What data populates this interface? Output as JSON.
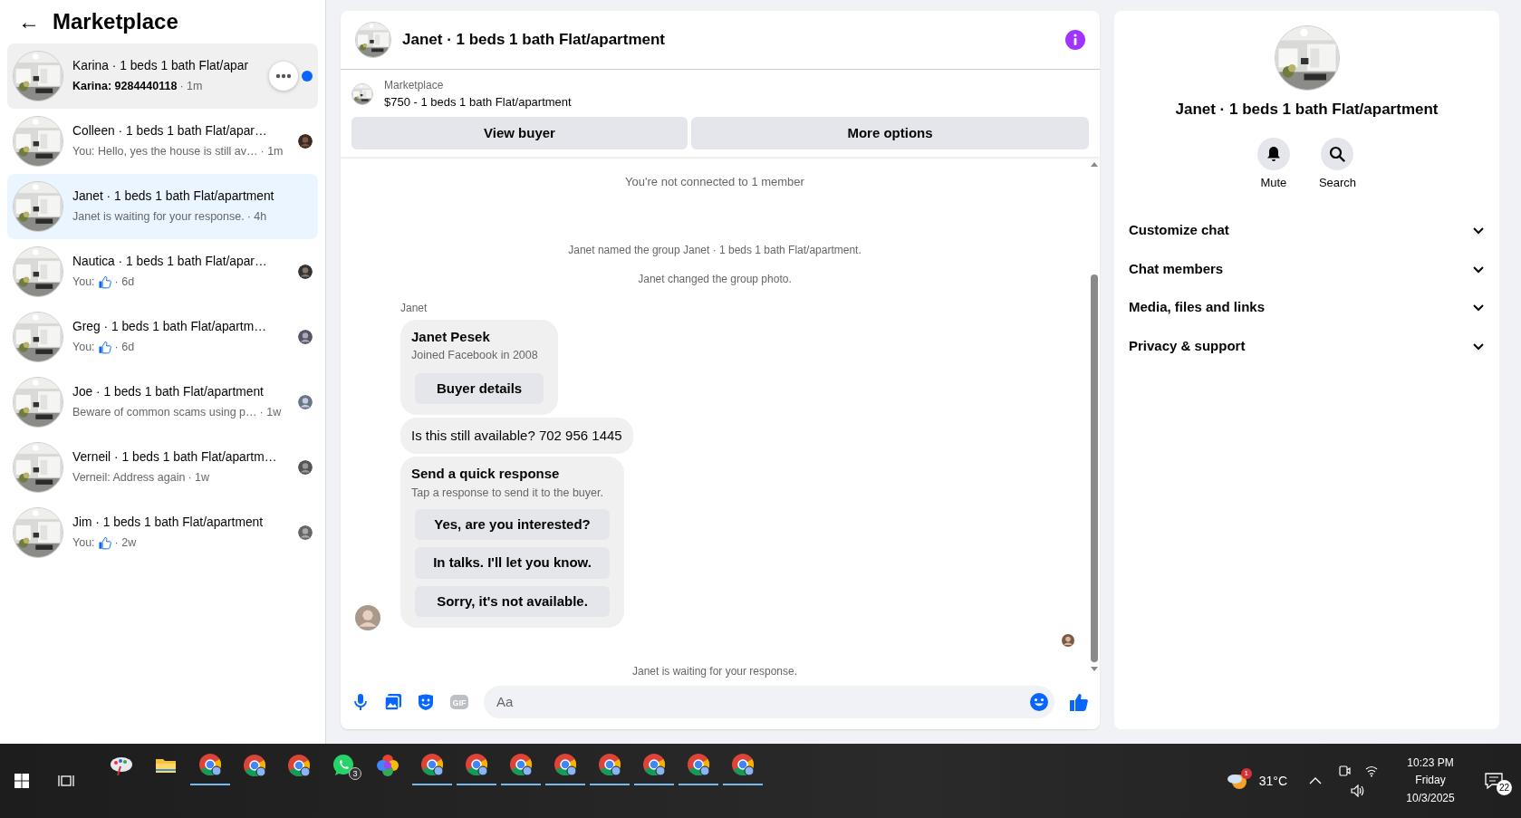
{
  "sidebar": {
    "back_label": "←",
    "title": "Marketplace",
    "items": [
      {
        "title": "Karina · 1 beds 1 bath Flat/apar",
        "preview": "Karina: 9284440118",
        "like": false,
        "time": "· 1m",
        "unread": true,
        "selected": false,
        "hovered": true
      },
      {
        "title": "Colleen · 1 beds 1 bath Flat/apar…",
        "preview": "You: Hello, yes the house is still av…",
        "like": false,
        "time": "· 1m",
        "unread": false,
        "selected": false,
        "hovered": false
      },
      {
        "title": "Janet · 1 beds 1 bath Flat/apartment",
        "preview": "Janet is waiting for your response.",
        "like": false,
        "time": "· 4h",
        "unread": false,
        "selected": true,
        "hovered": false,
        "seen": false
      },
      {
        "title": "Nautica · 1 beds 1 bath Flat/apar…",
        "preview": "You:",
        "like": true,
        "time": "· 6d",
        "unread": false,
        "selected": false,
        "hovered": false
      },
      {
        "title": "Greg · 1 beds 1 bath Flat/apartm…",
        "preview": "You:",
        "like": true,
        "time": "· 6d",
        "unread": false,
        "selected": false,
        "hovered": false
      },
      {
        "title": "Joe · 1 beds 1 bath Flat/apartment",
        "preview": "Beware of common scams using p…",
        "like": false,
        "time": "· 1w",
        "unread": false,
        "selected": false,
        "hovered": false
      },
      {
        "title": "Verneil · 1 beds 1 bath Flat/apartm…",
        "preview": "Verneil: Address again",
        "like": false,
        "time": "· 1w",
        "unread": false,
        "selected": false,
        "hovered": false
      },
      {
        "title": "Jim · 1 beds 1 bath Flat/apartment",
        "preview": "You:",
        "like": true,
        "time": "· 2w",
        "unread": false,
        "selected": false,
        "hovered": false
      }
    ]
  },
  "chat": {
    "title": "Janet · 1 beds 1 bath Flat/apartment",
    "listing": {
      "source": "Marketplace",
      "price_title": "$750 - 1 beds 1 bath Flat/apartment"
    },
    "actions": [
      "View buyer",
      "More options"
    ],
    "messages": [
      {
        "kind": "system",
        "text": "You're not connected to 1 member"
      },
      {
        "kind": "system",
        "text": "Janet named the group Janet · 1 beds 1 bath Flat/apartment."
      },
      {
        "kind": "system",
        "text": "Janet changed the group photo."
      },
      {
        "kind": "sender",
        "text": "Janet"
      },
      {
        "kind": "profile",
        "name": "Janet Pesek",
        "subtitle": "Joined Facebook in 2008",
        "button": "Buyer details"
      },
      {
        "kind": "bubble",
        "text": "Is this still available? 702 956 1445"
      },
      {
        "kind": "quick",
        "title": "Send a quick response",
        "subtitle": "Tap a response to send it to the buyer.",
        "options": [
          "Yes, are you interested?",
          "In talks. I'll let you know.",
          "Sorry, it's not available."
        ]
      },
      {
        "kind": "seen"
      },
      {
        "kind": "system",
        "text": "Janet is waiting for your response."
      }
    ],
    "composer": {
      "gif_label": "GIF",
      "placeholder": "Aa"
    }
  },
  "details": {
    "title": "Janet · 1 beds 1 bath Flat/apartment",
    "actions": [
      {
        "kind": "mute",
        "label": "Mute"
      },
      {
        "kind": "search",
        "label": "Search"
      }
    ],
    "sections": [
      {
        "label": "Customize chat",
        "expanded": false
      },
      {
        "label": "Chat members",
        "expanded": false
      },
      {
        "label": "Media, files and links",
        "expanded": false
      },
      {
        "label": "Privacy & support",
        "expanded": false
      }
    ]
  },
  "taskbar": {
    "apps": [
      {
        "kind": "paint",
        "running": false
      },
      {
        "kind": "folder",
        "running": false
      },
      {
        "kind": "browser",
        "running": true
      },
      {
        "kind": "browser",
        "running": false
      },
      {
        "kind": "browser",
        "running": false
      },
      {
        "kind": "chat",
        "running": false,
        "badge": "3"
      },
      {
        "kind": "flower",
        "running": false
      },
      {
        "kind": "browser",
        "running": true
      },
      {
        "kind": "browser",
        "running": true
      },
      {
        "kind": "browser",
        "running": true
      },
      {
        "kind": "browser",
        "running": true
      },
      {
        "kind": "browser",
        "running": true
      },
      {
        "kind": "browser",
        "running": true
      },
      {
        "kind": "browser",
        "running": true
      },
      {
        "kind": "browser",
        "running": true
      }
    ],
    "weather_badge": "1",
    "temperature": "31°C",
    "time": "10:23 PM",
    "day": "Friday",
    "date": "10/3/2025",
    "notifications": "22"
  }
}
